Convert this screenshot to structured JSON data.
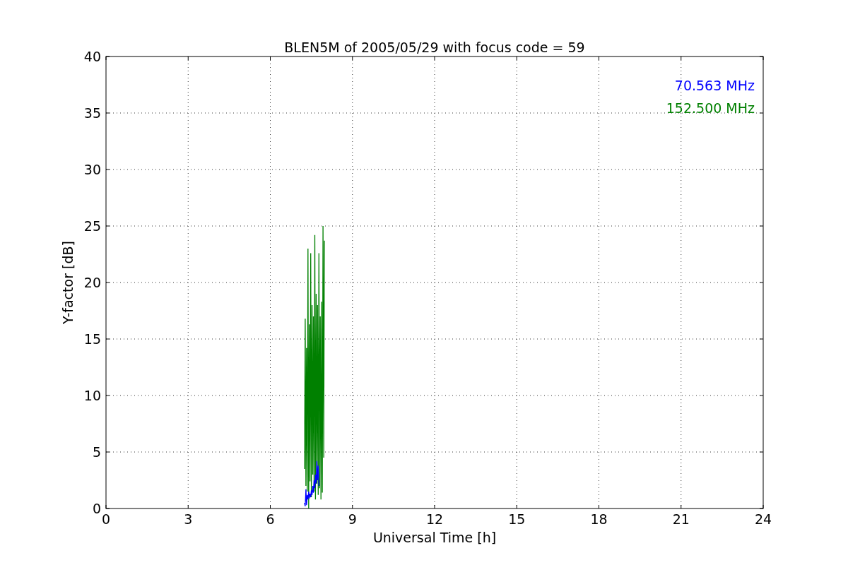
{
  "chart_data": {
    "type": "line",
    "title": "BLEN5M of 2005/05/29 with focus code = 59",
    "xlabel": "Universal Time [h]",
    "ylabel": "Y-factor [dB]",
    "xlim": [
      0,
      24
    ],
    "ylim": [
      0,
      40
    ],
    "xticks": [
      0,
      3,
      6,
      9,
      12,
      15,
      18,
      21,
      24
    ],
    "yticks": [
      0,
      5,
      10,
      15,
      20,
      25,
      30,
      35,
      40
    ],
    "grid": true,
    "x": [
      7.25,
      7.275,
      7.3,
      7.325,
      7.35,
      7.375,
      7.4,
      7.425,
      7.45,
      7.475,
      7.5,
      7.525,
      7.55,
      7.575,
      7.6,
      7.625,
      7.65,
      7.675,
      7.7,
      7.725,
      7.75,
      7.775,
      7.8,
      7.825,
      7.85,
      7.875,
      7.9,
      7.925,
      7.95,
      7.975
    ],
    "series": [
      {
        "name": "70.563 MHz",
        "color": "#0000ff",
        "values": [
          0.5,
          0.2,
          1.7,
          0.3,
          1.2,
          0.8,
          1.5,
          0.9,
          1.3,
          1.0,
          1.6,
          1.2,
          2.0,
          1.4,
          2.5,
          1.8,
          3.0,
          2.2,
          4.2,
          2.5,
          3.8,
          2.0,
          null,
          null,
          null,
          null,
          null,
          null,
          null,
          null
        ]
      },
      {
        "name": "152.500 MHz",
        "color": "#008000",
        "values": [
          3.5,
          16.8,
          2.0,
          14.2,
          1.5,
          23.0,
          0.0,
          16.3,
          2.4,
          22.6,
          1.0,
          18.0,
          3.0,
          17.0,
          1.5,
          24.2,
          0.8,
          19.0,
          2.2,
          18.0,
          1.2,
          22.6,
          1.8,
          17.0,
          0.8,
          18.3,
          1.4,
          25.0,
          4.5,
          23.7
        ]
      }
    ]
  }
}
